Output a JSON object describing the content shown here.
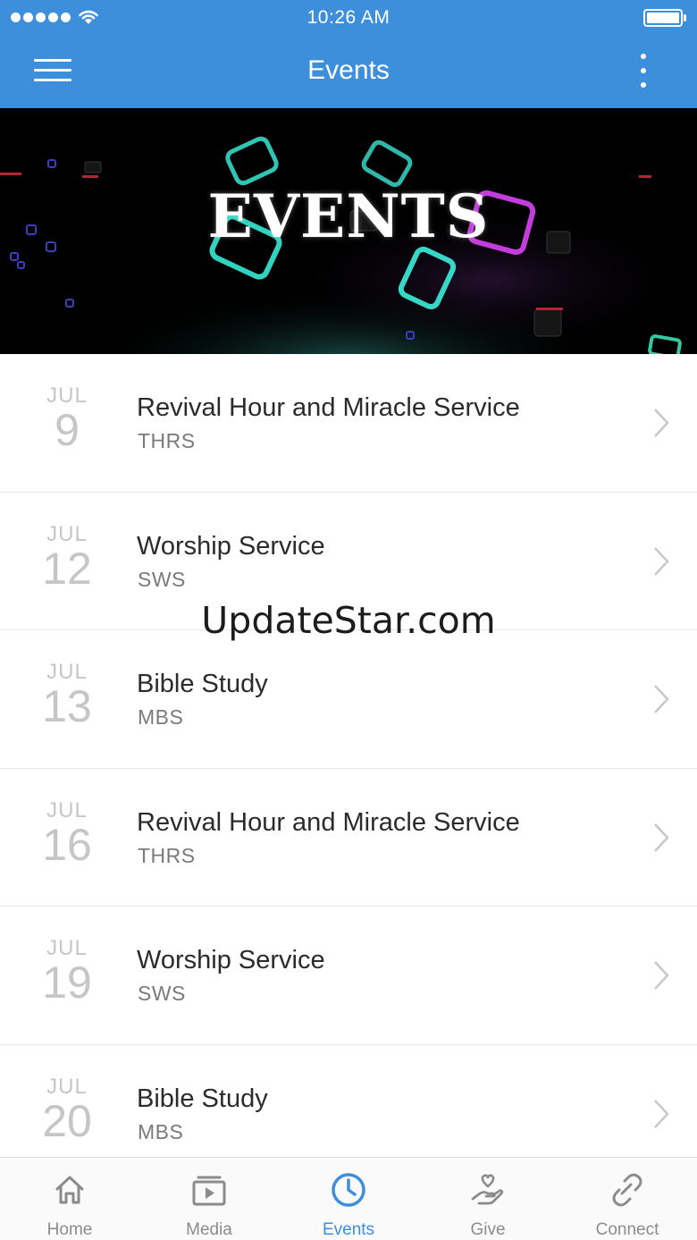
{
  "status_bar": {
    "time": "10:26 AM"
  },
  "nav": {
    "title": "Events",
    "menu_icon": "hamburger-menu-icon",
    "more_icon": "vertical-ellipsis-icon"
  },
  "banner": {
    "title": "EVENTS"
  },
  "events": [
    {
      "month": "JUL",
      "day": "9",
      "title": "Revival Hour and Miracle Service",
      "code": "THRS"
    },
    {
      "month": "JUL",
      "day": "12",
      "title": "Worship Service",
      "code": "SWS"
    },
    {
      "month": "JUL",
      "day": "13",
      "title": "Bible Study",
      "code": "MBS"
    },
    {
      "month": "JUL",
      "day": "16",
      "title": "Revival Hour and Miracle Service",
      "code": "THRS"
    },
    {
      "month": "JUL",
      "day": "19",
      "title": "Worship Service",
      "code": "SWS"
    },
    {
      "month": "JUL",
      "day": "20",
      "title": "Bible Study",
      "code": "MBS"
    }
  ],
  "watermark": "UpdateStar.com",
  "tabs": [
    {
      "label": "Home",
      "icon": "home-icon",
      "active": false
    },
    {
      "label": "Media",
      "icon": "media-icon",
      "active": false
    },
    {
      "label": "Events",
      "icon": "clock-icon",
      "active": true
    },
    {
      "label": "Give",
      "icon": "give-icon",
      "active": false
    },
    {
      "label": "Connect",
      "icon": "connect-icon",
      "active": false
    }
  ],
  "colors": {
    "accent": "#3d8fdc",
    "tab_inactive": "#8b8b8b",
    "date_text": "#c6c6c6"
  }
}
